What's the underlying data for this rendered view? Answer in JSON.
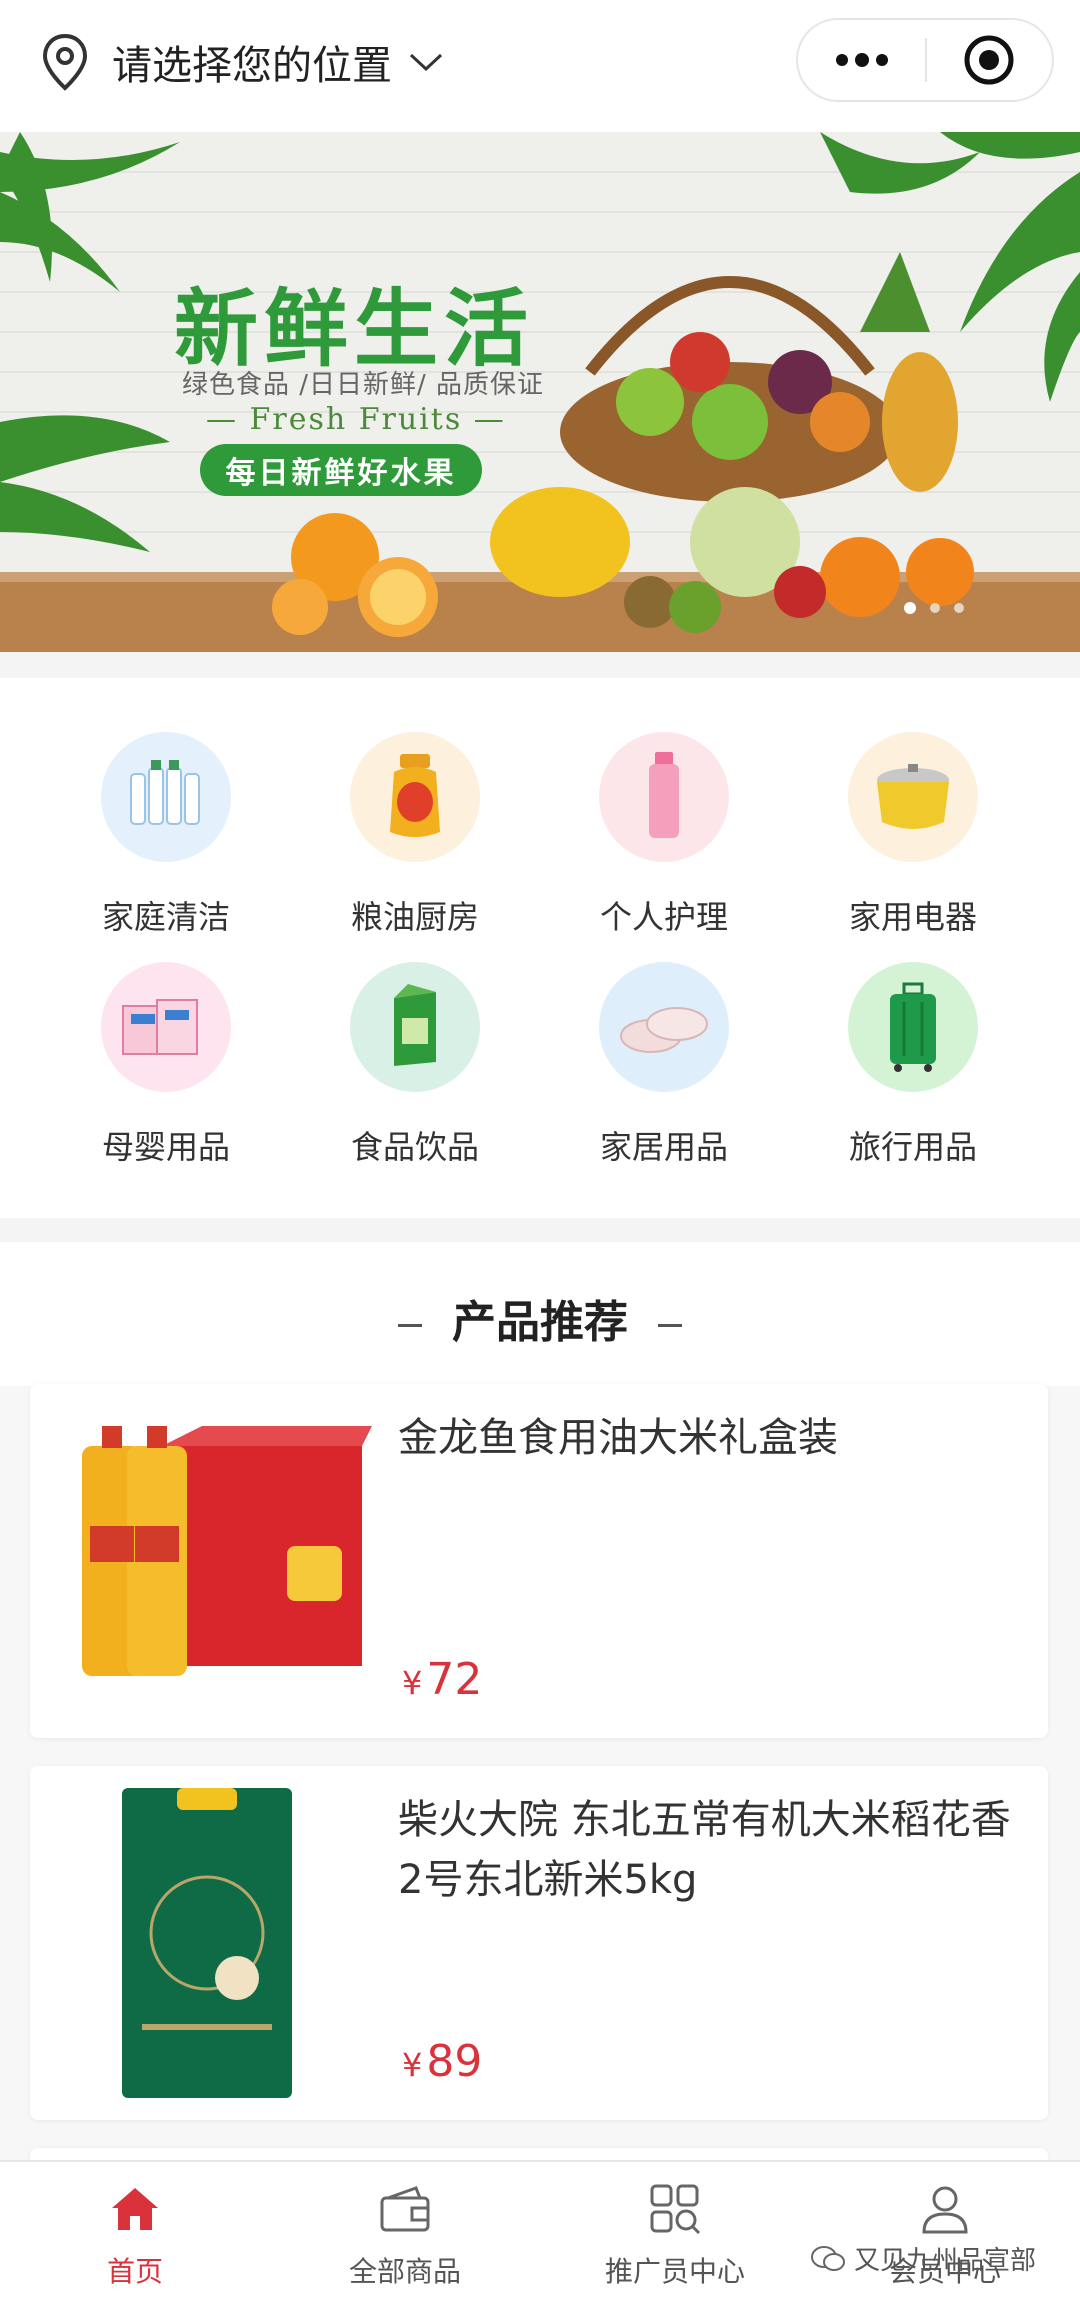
{
  "header": {
    "location_text": "请选择您的位置"
  },
  "banner": {
    "title": "新鲜生活",
    "subtitle": "绿色食品 /日日新鲜/ 品质保证",
    "english": "— Fresh Fruits —",
    "pill": "每日新鲜好水果",
    "dots": 3,
    "active_dot": 1
  },
  "categories": [
    {
      "label": "家庭清洁",
      "color": "#e4f0fb"
    },
    {
      "label": "粮油厨房",
      "color": "#fdf0dc"
    },
    {
      "label": "个人护理",
      "color": "#fde6ea"
    },
    {
      "label": "家用电器",
      "color": "#fdf0dc"
    },
    {
      "label": "母婴用品",
      "color": "#fde4ee"
    },
    {
      "label": "食品饮品",
      "color": "#d8f0e6"
    },
    {
      "label": "家居用品",
      "color": "#dfeefb"
    },
    {
      "label": "旅行用品",
      "color": "#d4f3d4"
    }
  ],
  "recommend": {
    "title": "产品推荐",
    "products": [
      {
        "name": "金龙鱼食用油大米礼盒装",
        "currency": "¥",
        "price": "72"
      },
      {
        "name": "柴火大院 东北五常有机大米稻花香2号东北新米5kg",
        "currency": "¥",
        "price": "89"
      }
    ]
  },
  "tabbar": {
    "tabs": [
      {
        "label": "首页",
        "active": true
      },
      {
        "label": "全部商品",
        "active": false
      },
      {
        "label": "推广员中心",
        "active": false
      },
      {
        "label": "会员中心",
        "active": false
      }
    ]
  },
  "watermark": "又见九州品宣部",
  "colors": {
    "accent": "#d9323b",
    "brand_green": "#2f9a3a"
  }
}
